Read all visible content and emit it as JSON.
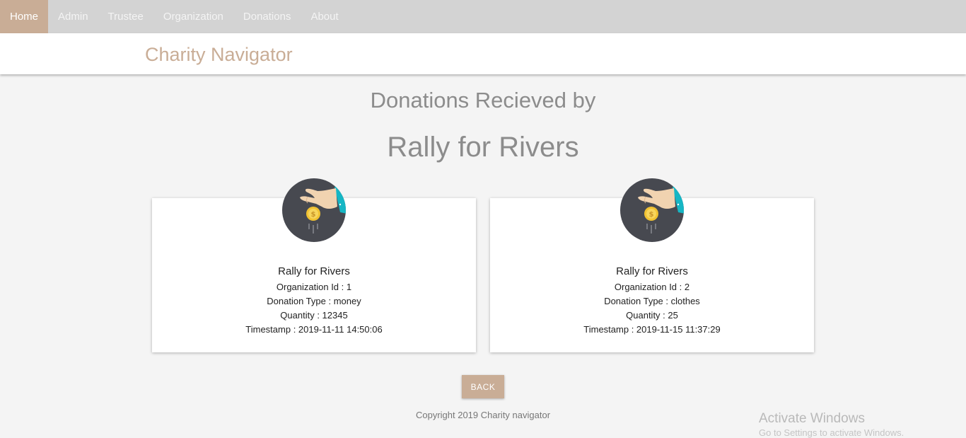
{
  "nav": {
    "items": [
      {
        "label": "Home",
        "active": true
      },
      {
        "label": "Admin"
      },
      {
        "label": "Trustee"
      },
      {
        "label": "Organization"
      },
      {
        "label": "Donations"
      },
      {
        "label": "About"
      }
    ]
  },
  "brand": {
    "title": "Charity Navigator"
  },
  "page": {
    "heading": "Donations Recieved by",
    "org_name": "Rally for Rivers"
  },
  "cards": [
    {
      "icon": "hand-coin-icon",
      "title": "Rally for Rivers",
      "org_id_label": "Organization Id : 1",
      "donation_type_label": "Donation Type : money",
      "quantity_label": "Quantity : 12345",
      "timestamp_label": "Timestamp : 2019-11-11 14:50:06"
    },
    {
      "icon": "hand-coin-icon",
      "title": "Rally for Rivers",
      "org_id_label": "Organization Id : 2",
      "donation_type_label": "Donation Type : clothes",
      "quantity_label": "Quantity : 25",
      "timestamp_label": "Timestamp : 2019-11-15 11:37:29"
    }
  ],
  "back_button": {
    "label": "BACK"
  },
  "footer": {
    "text": "Copyright 2019 Charity navigator"
  },
  "watermark": {
    "title": "Activate Windows",
    "subtitle": "Go to Settings to activate Windows."
  },
  "colors": {
    "accent": "#c9ad96",
    "nav_bg": "#d3d3d3",
    "page_bg": "#f4f4f4",
    "icon_circle": "#474950",
    "icon_cuff": "#16b6c4",
    "coin": "#f1c232"
  }
}
